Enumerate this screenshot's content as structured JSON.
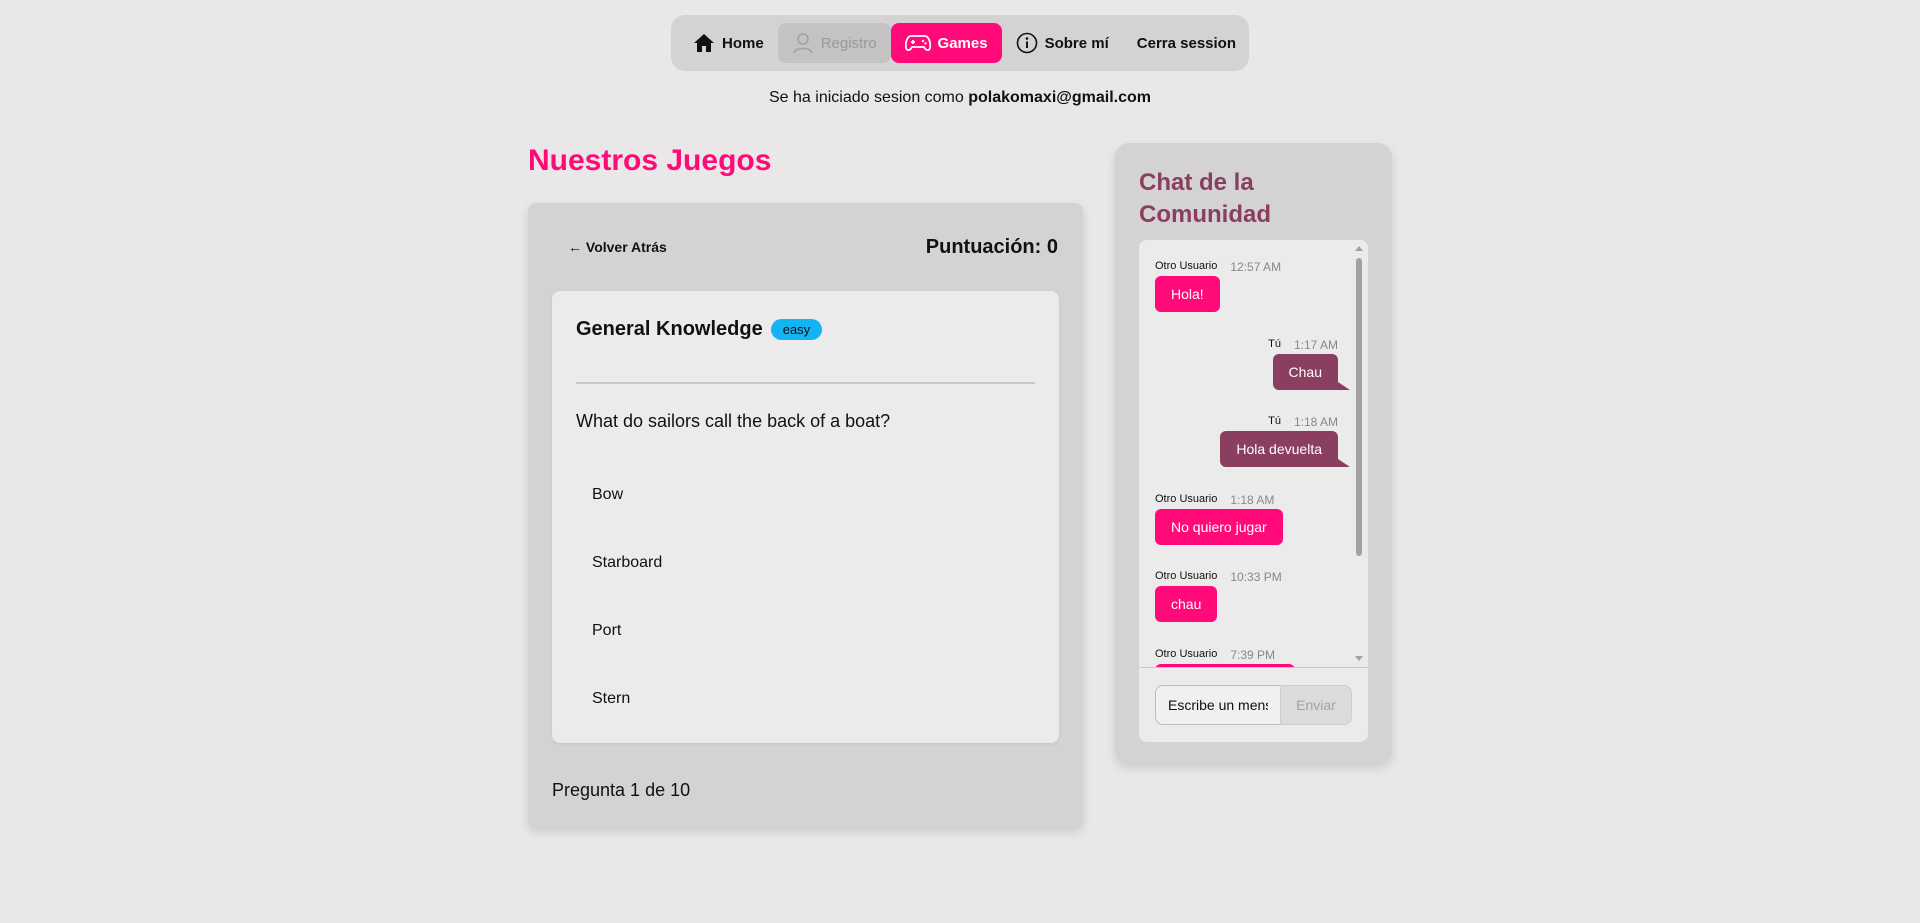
{
  "nav": {
    "items": [
      {
        "label": "Home",
        "icon": "home-icon",
        "state": "normal"
      },
      {
        "label": "Registro",
        "icon": "user-icon",
        "state": "disabled"
      },
      {
        "label": "Games",
        "icon": "gamepad-icon",
        "state": "active"
      },
      {
        "label": "Sobre mí",
        "icon": "info-icon",
        "state": "normal"
      },
      {
        "label": "Cerra session",
        "icon": "",
        "state": "normal"
      }
    ]
  },
  "session": {
    "prefix": "Se ha iniciado sesion como",
    "email": "polakomaxi@gmail.com"
  },
  "games": {
    "title": "Nuestros Juegos",
    "back_label": "← Volver Atrás",
    "score_label": "Puntuación: 0",
    "question": {
      "category": "General Knowledge",
      "difficulty": "easy",
      "text": "What do sailors call the back of a boat?",
      "answers": [
        "Bow",
        "Starboard",
        "Port",
        "Stern"
      ]
    },
    "progress": "Pregunta 1 de 10"
  },
  "chat": {
    "title": "Chat de la Comunidad",
    "messages": [
      {
        "author": "Otro Usuario",
        "time": "12:57 AM",
        "text": "Hola!",
        "mine": false
      },
      {
        "author": "Tú",
        "time": "1:17 AM",
        "text": "Chau",
        "mine": true
      },
      {
        "author": "Tú",
        "time": "1:18 AM",
        "text": "Hola devuelta",
        "mine": true
      },
      {
        "author": "Otro Usuario",
        "time": "1:18 AM",
        "text": "No quiero jugar",
        "mine": false
      },
      {
        "author": "Otro Usuario",
        "time": "10:33 PM",
        "text": "chau",
        "mine": false
      },
      {
        "author": "Otro Usuario",
        "time": "7:39 PM",
        "text": "",
        "mine": false
      }
    ],
    "input_value": "Escribe un mensaje...",
    "send_label": "Enviar"
  },
  "colors": {
    "accent": "#ff0a78",
    "chat_title": "#8a3e60",
    "mine_bubble": "#8a3e60",
    "badge": "#14b4f4"
  }
}
